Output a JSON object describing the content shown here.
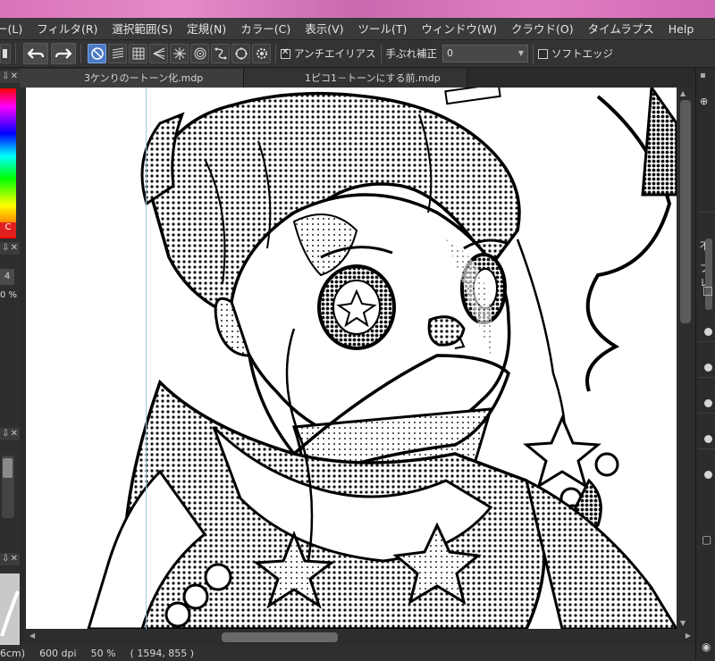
{
  "menu": [
    {
      "label": "ー(L)",
      "name": "menu-layer"
    },
    {
      "label": "フィルタ(R)",
      "name": "menu-filter"
    },
    {
      "label": "選択範囲(S)",
      "name": "menu-selection"
    },
    {
      "label": "定規(N)",
      "name": "menu-ruler"
    },
    {
      "label": "カラー(C)",
      "name": "menu-color"
    },
    {
      "label": "表示(V)",
      "name": "menu-view"
    },
    {
      "label": "ツール(T)",
      "name": "menu-tool"
    },
    {
      "label": "ウィンドウ(W)",
      "name": "menu-window"
    },
    {
      "label": "クラウド(O)",
      "name": "menu-cloud"
    },
    {
      "label": "タイムラプス",
      "name": "menu-timelapse"
    },
    {
      "label": "Help",
      "name": "menu-help"
    }
  ],
  "toolbar": {
    "antialias_label": "アンチエイリアス",
    "antialias_checked": true,
    "stabilizer_label": "手ぶれ補正",
    "stabilizer_value": "0",
    "soft_edge_label": "ソフトエッジ",
    "soft_edge_checked": false,
    "icons": [
      "undo-icon",
      "redo-icon",
      "snap-off-icon",
      "parallel-snap-icon",
      "grid-snap-icon",
      "perspective-snap-icon",
      "radial-snap-icon",
      "concentric-snap-icon",
      "curve-snap-icon",
      "ellipse-snap-icon",
      "snap-settings-icon"
    ]
  },
  "left_dock": {
    "color_sel": "C",
    "size_value": "4",
    "opacity_text": "0 %"
  },
  "tabs": [
    {
      "label": "3ケンりのートーン化.mdp",
      "active": true
    },
    {
      "label": "1ピコ1－トーンにする前.mdp",
      "active": false
    }
  ],
  "right_dock": {
    "text1": "不",
    "text2": "ブレ"
  },
  "status": {
    "size": "6cm)",
    "dpi": "600 dpi",
    "zoom": "50 %",
    "coords": "( 1594, 855 )"
  },
  "colors": {
    "menubar": "#3a3a3a",
    "toolbar": "#333333",
    "active_tool": "#4b79c4",
    "wallpaper": "#d873b8",
    "canvas": "#ffffff"
  }
}
